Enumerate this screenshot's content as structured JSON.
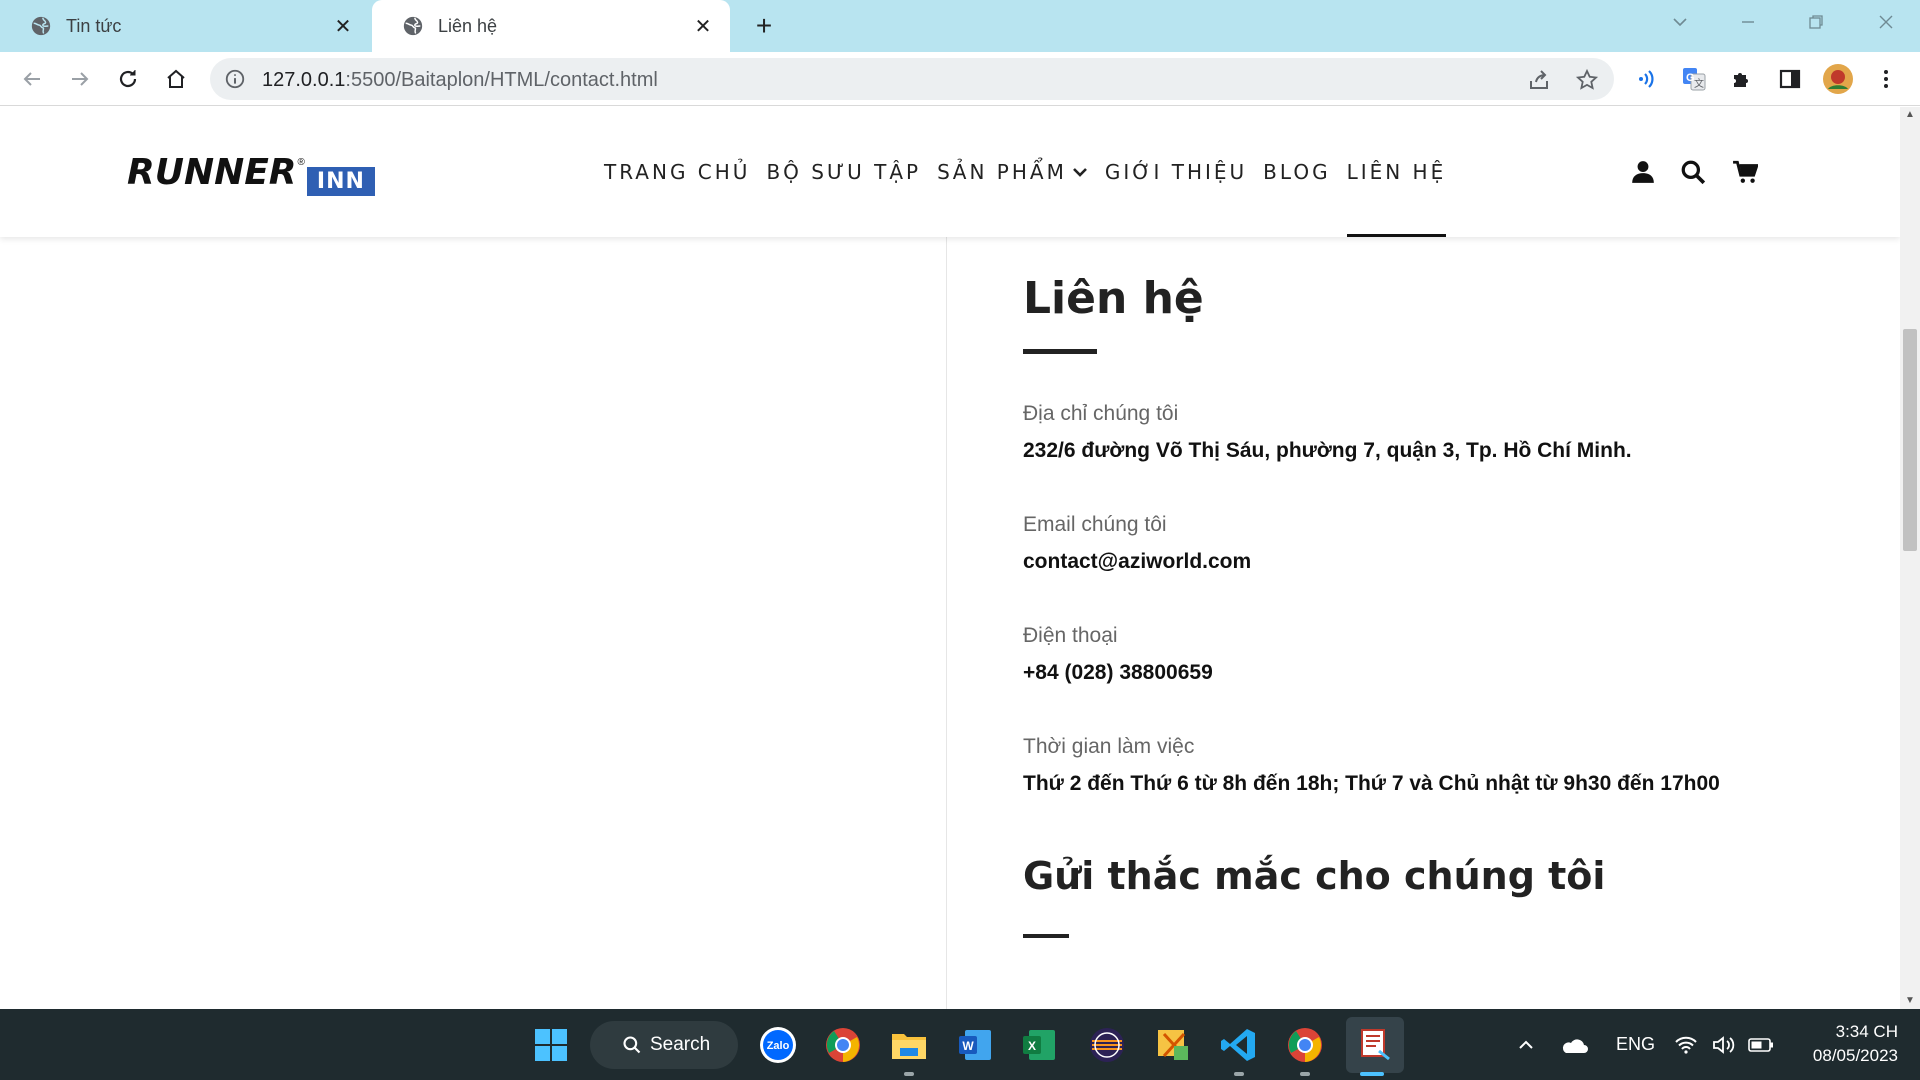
{
  "browser": {
    "tabs": [
      {
        "title": "Tin tức",
        "active": false
      },
      {
        "title": "Liên hệ",
        "active": true
      }
    ],
    "url_host": "127.0.0.1",
    "url_rest": ":5500/Baitaplon/HTML/contact.html"
  },
  "site": {
    "logo_main": "RUNNER",
    "logo_reg": "®",
    "logo_sub": "INN",
    "nav": [
      {
        "label": "TRANG CHỦ"
      },
      {
        "label": "BỘ SƯU TẬP"
      },
      {
        "label": "SẢN PHẨM",
        "has_dropdown": true
      },
      {
        "label": "GIỚI THIỆU"
      },
      {
        "label": "BLOG"
      },
      {
        "label": "LIÊN HỆ",
        "active": true
      }
    ]
  },
  "contact": {
    "title": "Liên hệ",
    "fields": [
      {
        "label": "Địa chỉ chúng tôi",
        "value": "232/6 đường Võ Thị Sáu, phường 7, quận 3, Tp. Hồ Chí Minh."
      },
      {
        "label": "Email chúng tôi",
        "value": "contact@aziworld.com"
      },
      {
        "label": "Điện thoại",
        "value": "+84 (028) 38800659"
      },
      {
        "label": "Thời gian làm việc",
        "value": "Thứ 2 đến Thứ 6 từ 8h đến 18h; Thứ 7 và Chủ nhật từ 9h30 đến 17h00"
      }
    ],
    "form_title": "Gửi thắc mắc cho chúng tôi"
  },
  "taskbar": {
    "search_label": "Search",
    "zalo_label": "Zalo",
    "language": "ENG",
    "time": "3:34 CH",
    "date": "08/05/2023"
  },
  "colors": {
    "tabstrip": "#b8e4f0",
    "brand_blue": "#2f5fb3",
    "taskbar": "#1f2b2f"
  }
}
